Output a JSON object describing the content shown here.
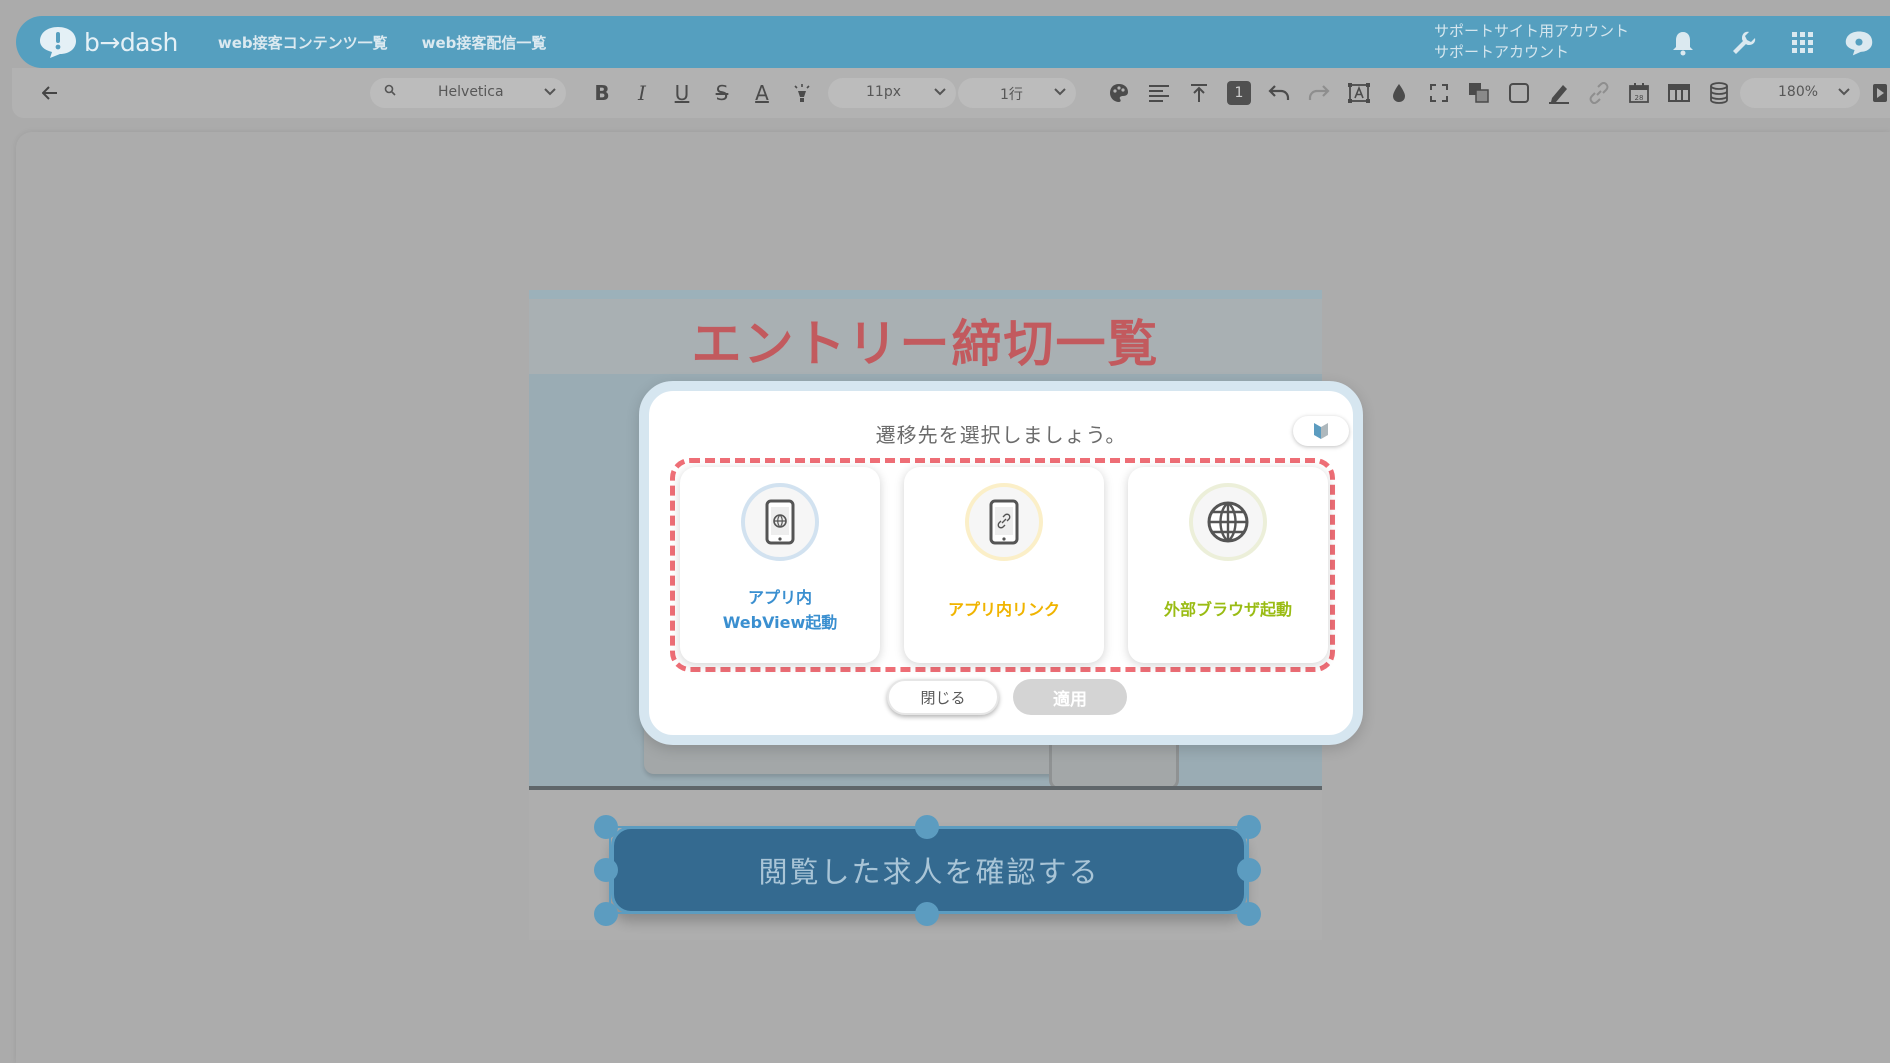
{
  "header": {
    "logo_text": "b→dash",
    "nav": [
      "web接客コンテンツ一覧",
      "web接客配信一覧"
    ],
    "account_line1": "サポートサイト用アカウント",
    "account_line2": "サポートアカウント",
    "icons": [
      "bell-icon",
      "wrench-icon",
      "apps-grid-icon",
      "user-avatar-icon"
    ]
  },
  "toolbar": {
    "back_icon": "arrow-left-icon",
    "font_family": "Helvetica",
    "font_size": "11px",
    "line_count": "1行",
    "layer_number": "1",
    "zoom": "180%",
    "icons": [
      "bold-icon",
      "italic-icon",
      "underline-icon",
      "strikethrough-icon",
      "font-color-icon",
      "highlight-icon",
      "palette-icon",
      "align-icon",
      "valign-top-icon",
      "undo-icon",
      "redo-icon",
      "text-box-icon",
      "drop-icon",
      "fullscreen-icon",
      "layers-icon",
      "border-icon",
      "pen-icon",
      "link-icon",
      "calendar-icon",
      "table-icon",
      "database-icon",
      "play-icon"
    ]
  },
  "document": {
    "title": "エントリー締切一覧",
    "cta_label": "閲覧した求人を確認する"
  },
  "modal": {
    "title": "遷移先を選択しましょう。",
    "options": [
      {
        "label_line1": "アプリ内",
        "label_line2": "WebView起動",
        "icon": "phone-globe-icon",
        "color": "#3a8fd0"
      },
      {
        "label_line1": "アプリ内リンク",
        "label_line2": "",
        "icon": "phone-link-icon",
        "color": "#f0b400"
      },
      {
        "label_line1": "外部ブラウザ起動",
        "label_line2": "",
        "icon": "globe-icon",
        "color": "#9abc14"
      }
    ],
    "close_label": "閉じる",
    "apply_label": "適用"
  }
}
